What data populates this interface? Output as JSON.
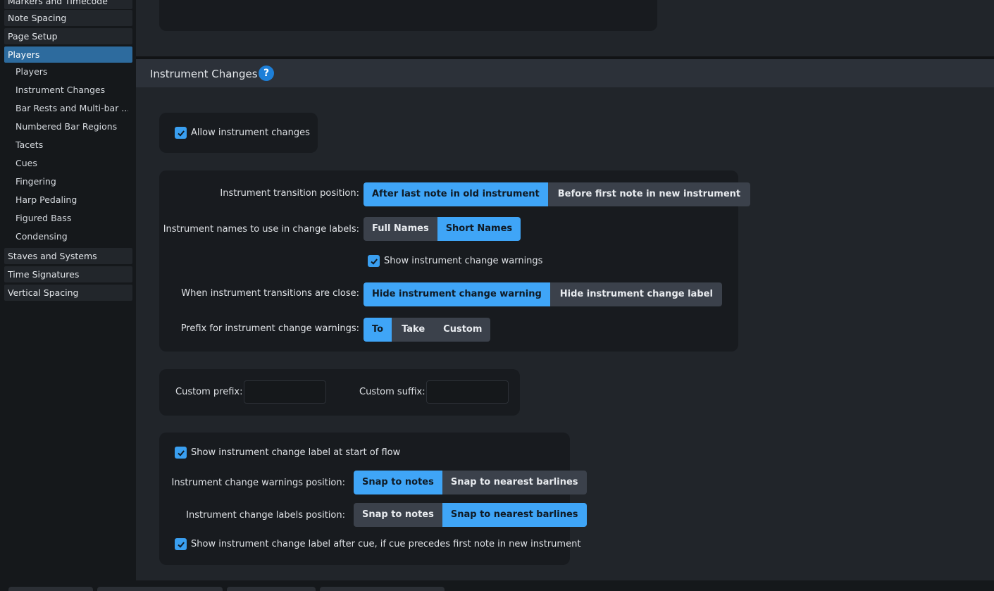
{
  "sidebar": {
    "items_top": [
      {
        "label": "Markers and Timecode"
      },
      {
        "label": "Note Spacing"
      },
      {
        "label": "Page Setup"
      },
      {
        "label": "Players"
      }
    ],
    "sub_items": [
      {
        "label": "Players"
      },
      {
        "label": "Instrument Changes"
      },
      {
        "label": "Bar Rests and Multi-bar ..."
      },
      {
        "label": "Numbered Bar Regions"
      },
      {
        "label": "Tacets"
      },
      {
        "label": "Cues"
      },
      {
        "label": "Fingering"
      },
      {
        "label": "Harp Pedaling"
      },
      {
        "label": "Figured Bass"
      },
      {
        "label": "Condensing"
      }
    ],
    "items_bottom": [
      {
        "label": "Staves and Systems"
      },
      {
        "label": "Time Signatures"
      },
      {
        "label": "Vertical Spacing"
      }
    ]
  },
  "section": {
    "title": "Instrument Changes",
    "help_icon": "?"
  },
  "allow": {
    "label": "Allow instrument changes",
    "checked": true
  },
  "transition_position": {
    "label": "Instrument transition position:",
    "options": [
      "After last note in old instrument",
      "Before first note in new instrument"
    ],
    "selected": 0
  },
  "names": {
    "label": "Instrument names to use in change labels:",
    "options": [
      "Full Names",
      "Short Names"
    ],
    "selected": 1
  },
  "show_warnings": {
    "label": "Show instrument change warnings",
    "checked": true
  },
  "close": {
    "label": "When instrument transitions are close:",
    "options": [
      "Hide instrument change warning",
      "Hide instrument change label"
    ],
    "selected": 0
  },
  "prefix": {
    "label": "Prefix for instrument change warnings:",
    "options": [
      "To",
      "Take",
      "Custom"
    ],
    "selected": 0
  },
  "custom": {
    "prefix_label": "Custom prefix:",
    "prefix_value": "",
    "suffix_label": "Custom suffix:",
    "suffix_value": ""
  },
  "start_of_flow": {
    "label": "Show instrument change label at start of flow",
    "checked": true
  },
  "warnings_position": {
    "label": "Instrument change warnings position:",
    "options": [
      "Snap to notes",
      "Snap to nearest barlines"
    ],
    "selected": 0
  },
  "labels_position": {
    "label": "Instrument change labels position:",
    "options": [
      "Snap to notes",
      "Snap to nearest barlines"
    ],
    "selected": 1
  },
  "after_cue": {
    "label": "Show instrument change label after cue, if cue precedes first note in new instrument",
    "checked": true
  },
  "colors": {
    "accent": "#3fa5f7",
    "active_sidebar": "#2d6b9e",
    "panel": "#181b1f"
  }
}
